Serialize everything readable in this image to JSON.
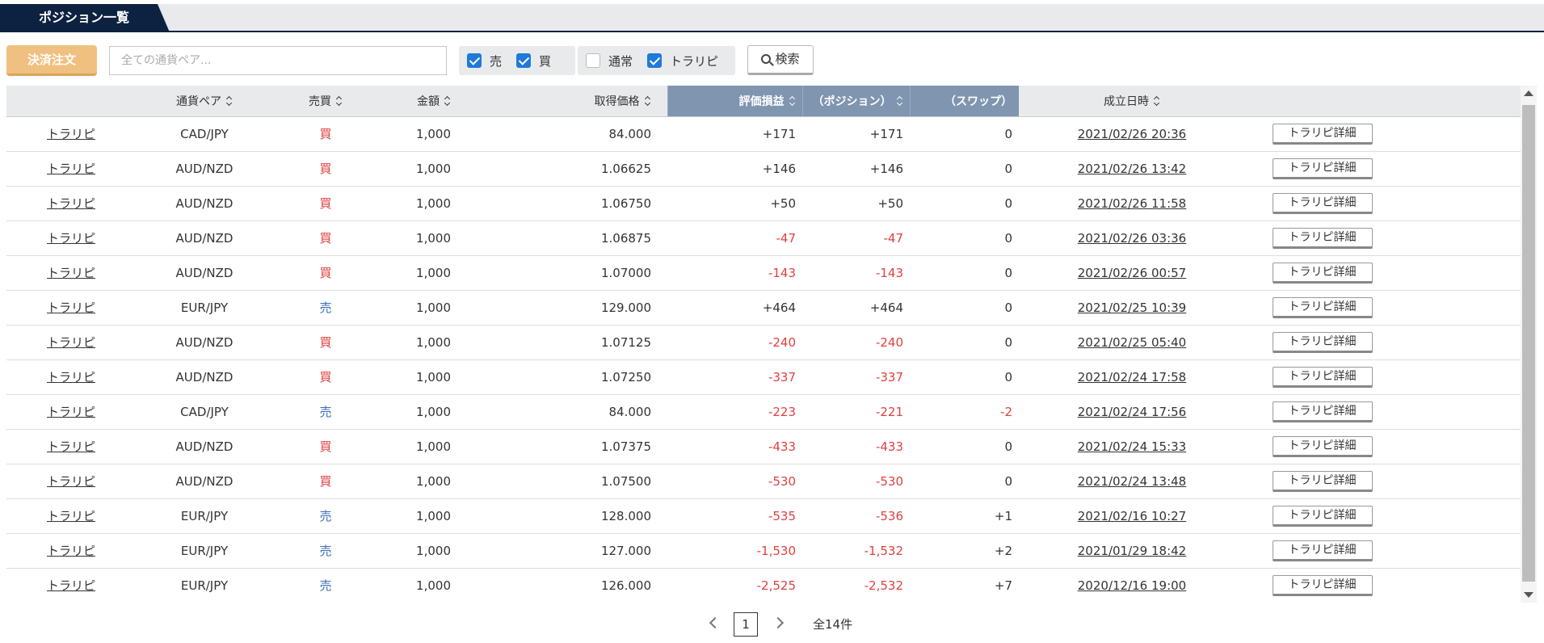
{
  "tabs": {
    "active_label": "ポジション一覧"
  },
  "toolbar": {
    "settle_label": "決済注文",
    "pair_placeholder": "全ての通貨ペア...",
    "side_filters": [
      {
        "label": "売",
        "checked": true
      },
      {
        "label": "買",
        "checked": true
      }
    ],
    "type_filters": [
      {
        "label": "通常",
        "checked": false
      },
      {
        "label": "トラリピ",
        "checked": true
      }
    ],
    "search_label": "検索"
  },
  "table": {
    "headers": [
      "",
      "通貨ペア",
      "売買",
      "金額",
      "取得価格",
      "評価損益",
      "（ポジション）",
      "（スワップ）",
      "成立日時",
      ""
    ],
    "detail_label": "トラリピ詳細",
    "rows": [
      {
        "type": "トラリピ",
        "pair": "CAD/JPY",
        "side": "買",
        "amount": "1,000",
        "price": "84.000",
        "pl": "+171",
        "pos": "+171",
        "swap": "0",
        "date": "2021/02/26 20:36"
      },
      {
        "type": "トラリピ",
        "pair": "AUD/NZD",
        "side": "買",
        "amount": "1,000",
        "price": "1.06625",
        "pl": "+146",
        "pos": "+146",
        "swap": "0",
        "date": "2021/02/26 13:42"
      },
      {
        "type": "トラリピ",
        "pair": "AUD/NZD",
        "side": "買",
        "amount": "1,000",
        "price": "1.06750",
        "pl": "+50",
        "pos": "+50",
        "swap": "0",
        "date": "2021/02/26 11:58"
      },
      {
        "type": "トラリピ",
        "pair": "AUD/NZD",
        "side": "買",
        "amount": "1,000",
        "price": "1.06875",
        "pl": "-47",
        "pos": "-47",
        "swap": "0",
        "date": "2021/02/26 03:36"
      },
      {
        "type": "トラリピ",
        "pair": "AUD/NZD",
        "side": "買",
        "amount": "1,000",
        "price": "1.07000",
        "pl": "-143",
        "pos": "-143",
        "swap": "0",
        "date": "2021/02/26 00:57"
      },
      {
        "type": "トラリピ",
        "pair": "EUR/JPY",
        "side": "売",
        "amount": "1,000",
        "price": "129.000",
        "pl": "+464",
        "pos": "+464",
        "swap": "0",
        "date": "2021/02/25 10:39"
      },
      {
        "type": "トラリピ",
        "pair": "AUD/NZD",
        "side": "買",
        "amount": "1,000",
        "price": "1.07125",
        "pl": "-240",
        "pos": "-240",
        "swap": "0",
        "date": "2021/02/25 05:40"
      },
      {
        "type": "トラリピ",
        "pair": "AUD/NZD",
        "side": "買",
        "amount": "1,000",
        "price": "1.07250",
        "pl": "-337",
        "pos": "-337",
        "swap": "0",
        "date": "2021/02/24 17:58"
      },
      {
        "type": "トラリピ",
        "pair": "CAD/JPY",
        "side": "売",
        "amount": "1,000",
        "price": "84.000",
        "pl": "-223",
        "pos": "-221",
        "swap": "-2",
        "date": "2021/02/24 17:56"
      },
      {
        "type": "トラリピ",
        "pair": "AUD/NZD",
        "side": "買",
        "amount": "1,000",
        "price": "1.07375",
        "pl": "-433",
        "pos": "-433",
        "swap": "0",
        "date": "2021/02/24 15:33"
      },
      {
        "type": "トラリピ",
        "pair": "AUD/NZD",
        "side": "買",
        "amount": "1,000",
        "price": "1.07500",
        "pl": "-530",
        "pos": "-530",
        "swap": "0",
        "date": "2021/02/24 13:48"
      },
      {
        "type": "トラリピ",
        "pair": "EUR/JPY",
        "side": "売",
        "amount": "1,000",
        "price": "128.000",
        "pl": "-535",
        "pos": "-536",
        "swap": "+1",
        "date": "2021/02/16 10:27"
      },
      {
        "type": "トラリピ",
        "pair": "EUR/JPY",
        "side": "売",
        "amount": "1,000",
        "price": "127.000",
        "pl": "-1,530",
        "pos": "-1,532",
        "swap": "+2",
        "date": "2021/01/29 18:42"
      },
      {
        "type": "トラリピ",
        "pair": "EUR/JPY",
        "side": "売",
        "amount": "1,000",
        "price": "126.000",
        "pl": "-2,525",
        "pos": "-2,532",
        "swap": "+7",
        "date": "2020/12/16 19:00"
      }
    ]
  },
  "pagination": {
    "current": "1",
    "total": "全14件"
  },
  "colors": {
    "navy": "#0d2240",
    "header_highlight": "#7f95b0",
    "negative": "#e04040",
    "sell": "#3a6fb8",
    "settle_button": "#f0c080",
    "checkbox": "#1f7ad9"
  }
}
